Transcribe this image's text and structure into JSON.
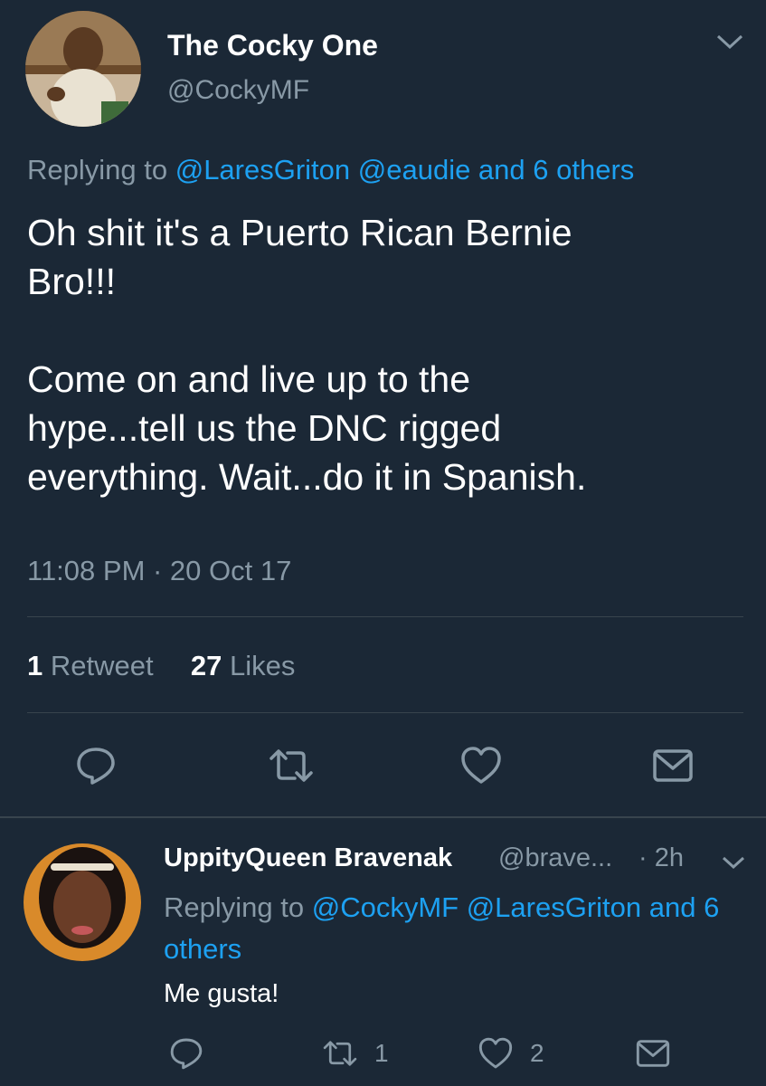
{
  "tweet": {
    "display_name": "The Cocky One",
    "handle": "@CockyMF",
    "replying_prefix": "Replying to ",
    "replying_mentions": "@LaresGriton @eaudie and 6 others",
    "text": "Oh shit it's a Puerto Rican Bernie\nBro!!!\n\nCome on and live up to the\nhype...tell us the DNC rigged\neverything. Wait...do it in Spanish.",
    "timestamp": "11:08 PM · 20 Oct 17",
    "retweet_count": "1",
    "retweet_label": "Retweet",
    "like_count": "27",
    "like_label": "Likes",
    "icons": [
      "reply-icon",
      "retweet-icon",
      "like-icon",
      "share-icon",
      "chevron-down-icon"
    ]
  },
  "reply": {
    "display_name": "UppityQueen Bravenak",
    "handle": "@brave...",
    "time": "· 2h",
    "replying_prefix": "Replying to ",
    "replying_mentions": "@CockyMF @LaresGriton and 6 others",
    "text": "Me gusta!",
    "retweet_count": "1",
    "like_count": "2"
  },
  "colors": {
    "background": "#1b2836",
    "accent": "#1da1f2",
    "secondary_text": "#8899a6",
    "divider": "#38444d"
  }
}
